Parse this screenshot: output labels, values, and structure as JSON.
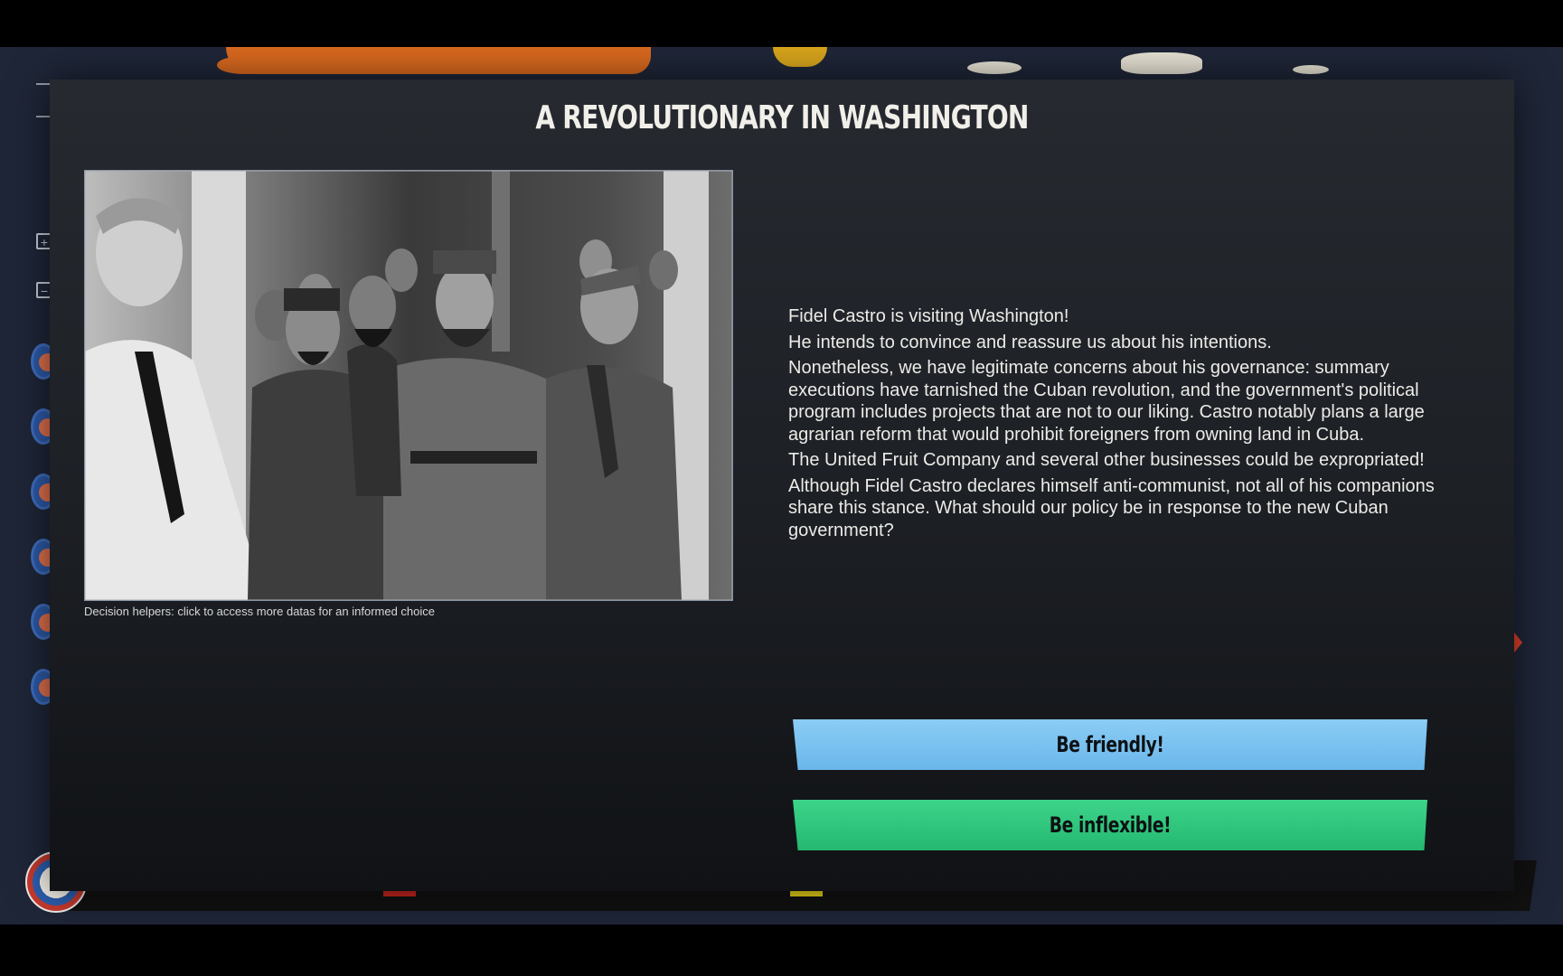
{
  "event": {
    "title": "A REVOLUTIONARY IN WASHINGTON",
    "photo_alt": "photo",
    "caption": "Decision helpers: click to access more datas for an informed choice",
    "paragraphs": [
      "Fidel Castro is visiting Washington!",
      "He intends to convince and reassure us about his intentions.",
      "Nonetheless, we have legitimate concerns about his governance: summary executions have tarnished the Cuban revolution, and the government's political program includes projects that are not to our liking. Castro notably plans a large agrarian reform that would prohibit foreigners from owning land in Cuba.",
      "The United Fruit Company and several other businesses could be expropriated!",
      "Although Fidel Castro declares himself anti-communist, not all of his companions share this stance. What should our policy be in response to the new Cuban government?"
    ],
    "choices": [
      {
        "label": "Be friendly!",
        "color": "#7cc3f0"
      },
      {
        "label": "Be inflexible!",
        "color": "#2cc77c"
      }
    ]
  },
  "colors": {
    "dialog_bg": "#23272d",
    "map_bg": "#1f2638",
    "accent_red": "#e0402c"
  },
  "icons": [
    "zoom-in-icon",
    "zoom-out-icon",
    "gear-icon",
    "globe-icon",
    "arrow-right-icon"
  ]
}
